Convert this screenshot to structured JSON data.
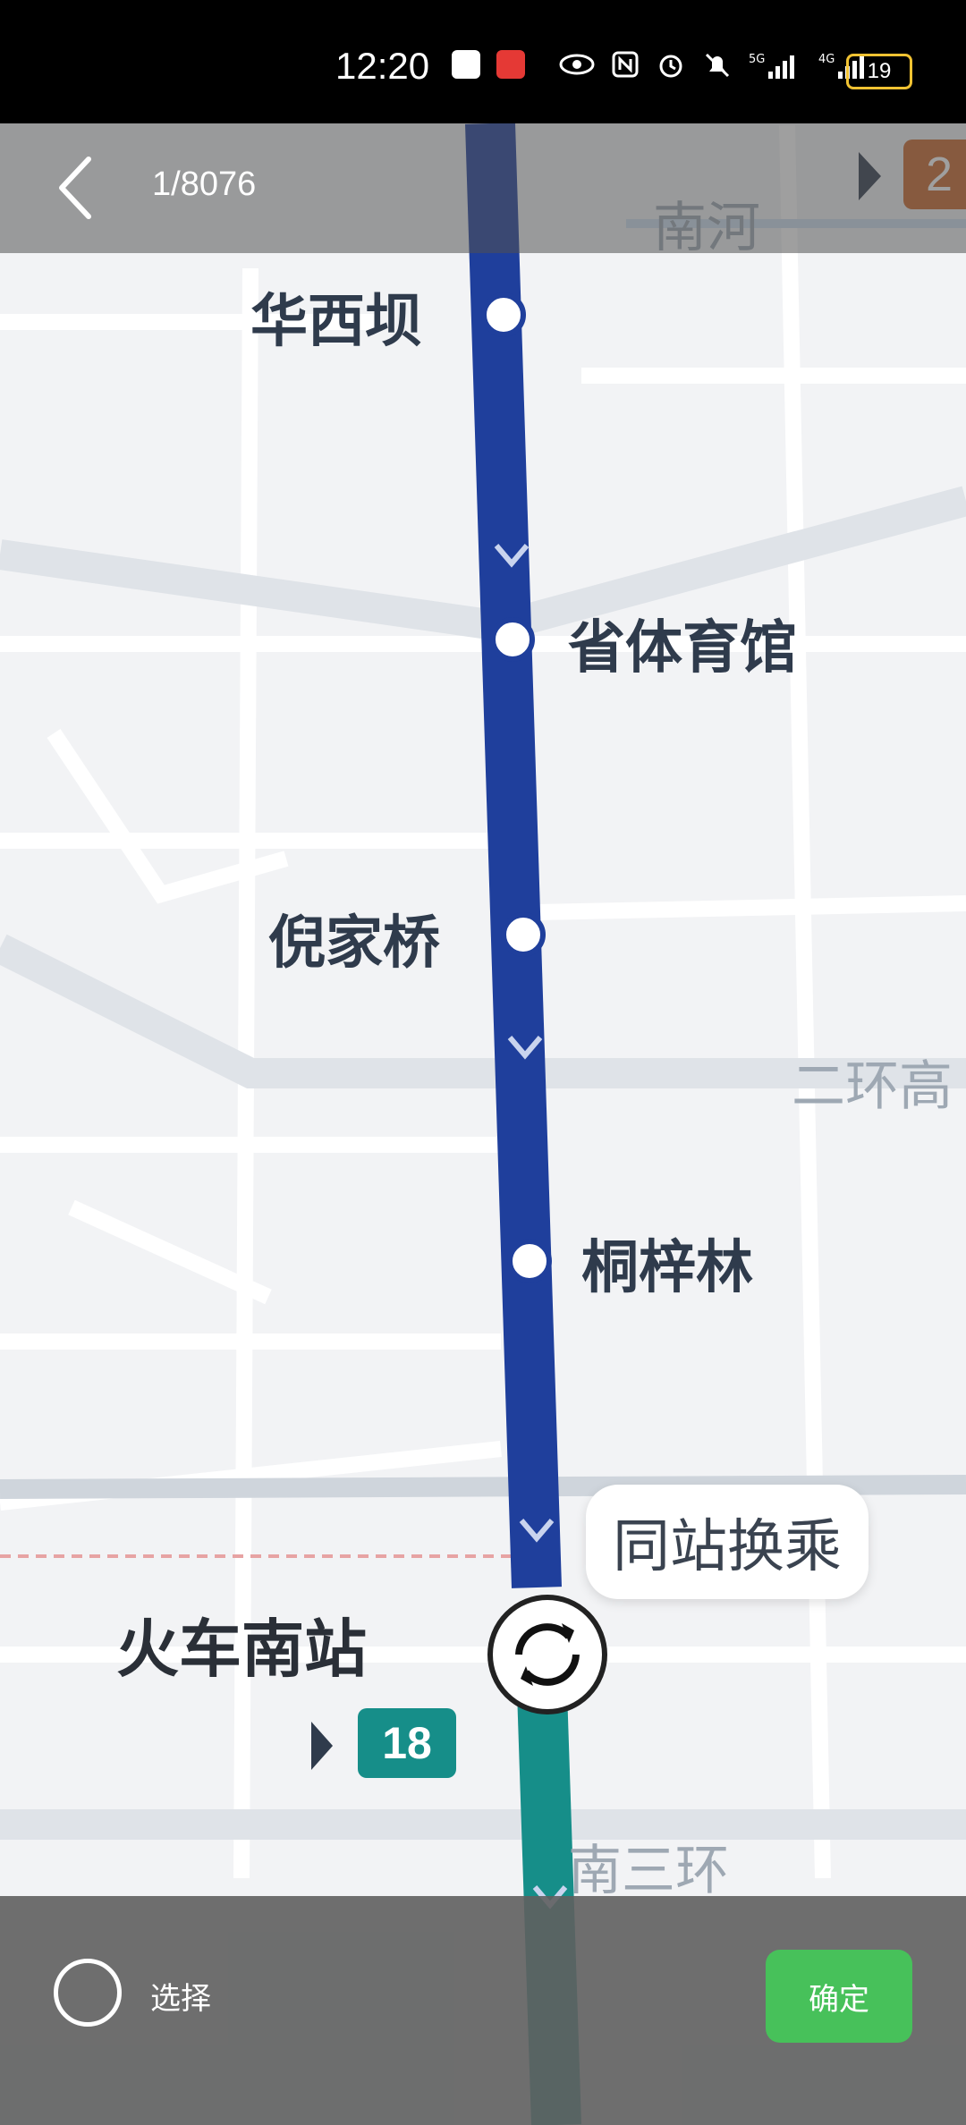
{
  "status": {
    "time": "12:20",
    "battery": "19"
  },
  "header": {
    "counter": "1/8076"
  },
  "stations": [
    {
      "name": "华西坝"
    },
    {
      "name": "省体育馆"
    },
    {
      "name": "倪家桥"
    },
    {
      "name": "桐梓林"
    },
    {
      "name": "火车南站"
    }
  ],
  "road_labels": {
    "top": "南河",
    "ring2": "二环高",
    "ring3": "南三环"
  },
  "transfer_bubble": "同站换乘",
  "line_badges": {
    "line18": "18",
    "line2": "2"
  },
  "footer": {
    "select_label": "选择",
    "confirm_label": "确定"
  },
  "colors": {
    "line_blue": "#1f3f9c",
    "line_teal": "#168e89",
    "confirm_green": "#47c15a"
  }
}
